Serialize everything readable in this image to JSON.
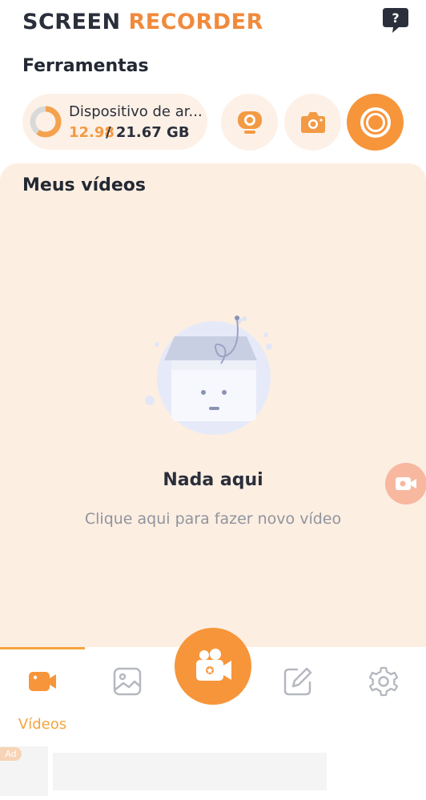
{
  "header": {
    "title_part1": "SCREEN",
    "title_part2": "RECORDER",
    "help_icon": "question-bubble-icon"
  },
  "tools": {
    "title": "Ferramentas",
    "storage": {
      "name": "Dispositivo de ar...",
      "used": "12.98",
      "total": "/ 21.67 GB",
      "used_fraction": 0.6
    },
    "buttons": [
      {
        "icon": "webcam-icon"
      },
      {
        "icon": "camera-icon"
      },
      {
        "icon": "record-icon"
      }
    ]
  },
  "videos": {
    "title": "Meus vídeos",
    "empty_title": "Nada aqui",
    "empty_hint": "Clique aqui para fazer novo vídeo"
  },
  "nav": {
    "items": [
      {
        "label": "Vídeos",
        "icon": "video-camera-icon",
        "active": true
      },
      {
        "label": "",
        "icon": "image-icon"
      },
      {
        "label": "",
        "icon": "record-video-icon"
      },
      {
        "label": "",
        "icon": "edit-icon"
      },
      {
        "label": "",
        "icon": "gear-icon"
      }
    ]
  },
  "ad": {
    "badge": "Ad"
  },
  "colors": {
    "accent": "#f7953a",
    "accent_light": "#fdf1e7",
    "panel_bg": "#fdeee2",
    "nav_active": "#f4a53f"
  }
}
